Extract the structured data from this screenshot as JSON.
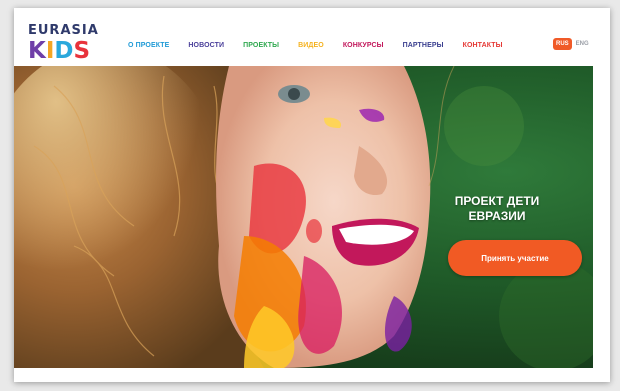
{
  "logo": {
    "top_text": "EURASIA",
    "letters": [
      {
        "char": "K",
        "color": "#6f3fa8"
      },
      {
        "char": "I",
        "color": "#f5a623"
      },
      {
        "char": "D",
        "color": "#2aa8dc"
      },
      {
        "char": "S",
        "color": "#e8333c"
      }
    ]
  },
  "nav": {
    "items": [
      {
        "label": "О ПРОЕКТЕ",
        "color": "#1f9ad6"
      },
      {
        "label": "НОВОСТИ",
        "color": "#4a3f9a"
      },
      {
        "label": "ПРОЕКТЫ",
        "color": "#2fa84f"
      },
      {
        "label": "ВИДЕО",
        "color": "#f5b21f"
      },
      {
        "label": "КОНКУРСЫ",
        "color": "#c2185b"
      },
      {
        "label": "ПАРТНЕРЫ",
        "color": "#3a3f8f"
      },
      {
        "label": "КОНТАКТЫ",
        "color": "#e53935"
      }
    ]
  },
  "lang": {
    "active": "RUS",
    "other": "ENG"
  },
  "hero": {
    "title_line1": "ПРОЕКТ ДЕТИ",
    "title_line2": "ЕВРАЗИИ",
    "button_label": "Принять участие",
    "accent_color": "#f15a24"
  }
}
